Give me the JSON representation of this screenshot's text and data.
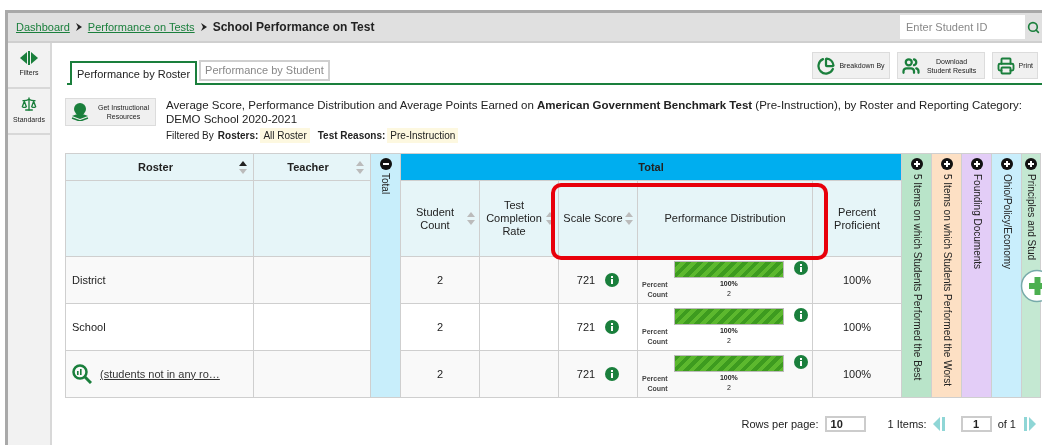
{
  "breadcrumb": {
    "links": [
      "Dashboard",
      "Performance on Tests"
    ],
    "current": "School Performance on Test"
  },
  "search": {
    "placeholder": "Enter Student ID"
  },
  "sidebar": {
    "items": [
      {
        "kind": "filters",
        "label": "Filters"
      },
      {
        "kind": "standards",
        "label": "Standards"
      }
    ]
  },
  "tabs": [
    {
      "label": "Performance by Roster",
      "selected": true
    },
    {
      "label": "Performance by Student",
      "selected": false
    }
  ],
  "toolbar": [
    {
      "kind": "breakdown",
      "label": "Breakdown By"
    },
    {
      "kind": "download",
      "label": "Download Student Results"
    },
    {
      "kind": "print",
      "label": "Print"
    }
  ],
  "resources_button": "Get Instructional Resources",
  "title_lines": [
    "Average Score, Performance Distribution and Average Points Earned on **American Government Benchmark Test** (Pre-Instruction), by Roster and Reporting Category:",
    "DEMO School 2020-2021"
  ],
  "filters": {
    "prefix": "Filtered By",
    "items": [
      {
        "label": "Rosters:",
        "value": "All Roster"
      },
      {
        "label": "Test Reasons:",
        "value": "Pre-Instruction"
      }
    ]
  },
  "table": {
    "columns": [
      {
        "label": "Roster",
        "sorted": true
      },
      {
        "label": "Teacher",
        "sorted": false
      }
    ],
    "total_group": {
      "label": "Total",
      "collapsed_label": "Total",
      "expanded": true
    },
    "metrics": [
      {
        "label": "Student Count",
        "sorted": false
      },
      {
        "label": "Test Completion Rate",
        "sorted": false
      },
      {
        "label": "Scale Score",
        "sorted": false
      },
      {
        "label": "Performance Distribution"
      },
      {
        "label": "Percent Proficient"
      }
    ],
    "categories": [
      {
        "label": "5 Items on which Students Performed the Best",
        "color": "#b9e4c9",
        "expanded": false
      },
      {
        "label": "5 Items on which Students Performed the Worst",
        "color": "#fde0c4",
        "expanded": false
      },
      {
        "label": "Founding Documents",
        "color": "#e3cdf7",
        "expanded": false
      },
      {
        "label": "Ohio/Policy/Economy",
        "color": "#c9eefc",
        "expanded": false
      },
      {
        "label": "Principles and Stud",
        "color": "#c4e8d2",
        "expanded": false
      }
    ],
    "rows": [
      {
        "kind": "text",
        "roster": "District",
        "student_count": "2",
        "scale_score": "721",
        "distribution": {
          "level": 1,
          "percent_label": "Percent",
          "percent": "100%",
          "count_label": "Count",
          "count": "2"
        },
        "percent_proficient": "100%"
      },
      {
        "kind": "text",
        "roster": "School",
        "student_count": "2",
        "scale_score": "721",
        "distribution": {
          "level": 1,
          "percent_label": "Percent",
          "percent": "100%",
          "count_label": "Count",
          "count": "2"
        },
        "percent_proficient": "100%"
      },
      {
        "kind": "link",
        "roster": "(students not in any ro…",
        "student_count": "2",
        "scale_score": "721",
        "distribution": {
          "level": 1,
          "percent_label": "Percent",
          "percent": "100%",
          "count_label": "Count",
          "count": "2"
        },
        "percent_proficient": "100%"
      }
    ]
  },
  "pagination": {
    "rows_label": "Rows per page:",
    "rows_per_page": "10",
    "items": "1 Items:",
    "page": "1",
    "of": "of 1"
  }
}
